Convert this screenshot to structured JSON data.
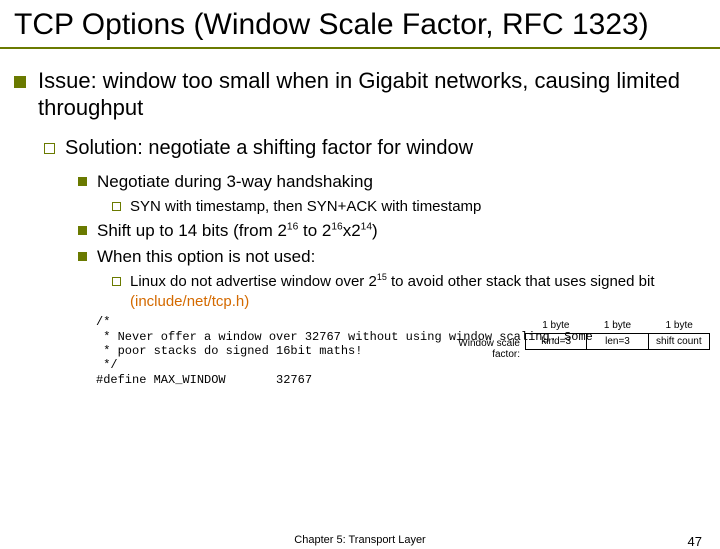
{
  "title": "TCP Options (Window Scale Factor, RFC 1323)",
  "issue": "Issue: window too small when in Gigabit networks, causing limited throughput",
  "solution": "Solution: negotiate a shifting factor for window",
  "p_negotiate": "Negotiate during 3-way handshaking",
  "p_syn": "SYN with timestamp, then SYN+ACK with timestamp",
  "shift": {
    "pre": "Shift up to 14 bits (from 2",
    "sup1": "16",
    "mid": " to 2",
    "sup2": "16",
    "x": "x2",
    "sup3": "14",
    "post": ")"
  },
  "notused": "When this option is not used:",
  "linux": {
    "pre": "Linux do not advertise window over 2",
    "sup": "15",
    "post": " to avoid other stack that uses signed bit ",
    "file": "(include/net/tcp.h)"
  },
  "diagram": {
    "side": "Window scale factor:",
    "top": [
      "1 byte",
      "1 byte",
      "1 byte"
    ],
    "cells": [
      "kind=3",
      "len=3",
      "shift count"
    ]
  },
  "code": "/*\n * Never offer a window over 32767 without using window scaling. Some\n * poor stacks do signed 16bit maths!\n */\n#define MAX_WINDOW       32767",
  "footer_center": "Chapter 5: Transport Layer",
  "footer_page": "47"
}
